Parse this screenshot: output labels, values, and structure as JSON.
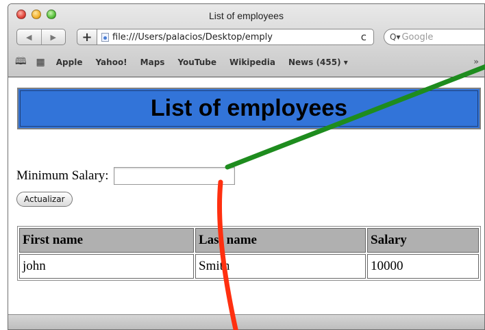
{
  "window": {
    "title": "List of employees"
  },
  "toolbar": {
    "back_label": "◀",
    "forward_label": "▶",
    "add_label": "+",
    "url": "file:///Users/palacios/Desktop/emply",
    "reload_label": "c",
    "search_placeholder": "Google"
  },
  "bookmarks": {
    "items": [
      "Apple",
      "Yahoo!",
      "Maps",
      "YouTube",
      "Wikipedia",
      "News (455) ▾"
    ],
    "more": "»"
  },
  "page": {
    "heading": "List of employees",
    "form": {
      "label": "Minimum Salary:",
      "value": "",
      "button_label": "Actualizar"
    },
    "table": {
      "headers": [
        "First name",
        "Last name",
        "Salary"
      ],
      "rows": [
        [
          "john",
          "Smith",
          "10000"
        ]
      ]
    }
  },
  "colors": {
    "banner": "#3274d9",
    "header_cell": "#b0b0b0",
    "annotation_green": "#1e8c1e",
    "annotation_red": "#ff3010"
  }
}
